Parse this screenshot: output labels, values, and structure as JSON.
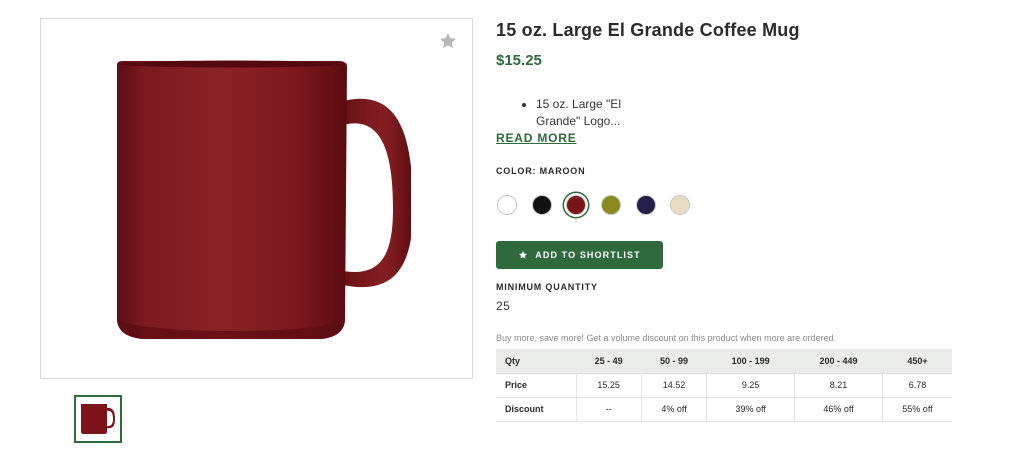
{
  "product": {
    "title": "15 oz. Large El Grande Coffee Mug",
    "price": "$15.25",
    "description_bullets": [
      "15 oz. Large \"El Grande\" Logo..."
    ],
    "read_more": "READ MORE"
  },
  "images": {
    "main_alt_icon": "mug-image",
    "favorite_icon": "star-icon",
    "thumbnail_icon": "mug-thumbnail"
  },
  "color": {
    "label": "COLOR: MAROON",
    "swatches": [
      {
        "name": "white",
        "hex": "#ffffff"
      },
      {
        "name": "black",
        "hex": "#111111"
      },
      {
        "name": "maroon",
        "hex": "#7a1418",
        "selected": true
      },
      {
        "name": "olive",
        "hex": "#8a8a1e"
      },
      {
        "name": "navy",
        "hex": "#23214a"
      },
      {
        "name": "almond",
        "hex": "#e8dcc4"
      }
    ]
  },
  "shortlist": {
    "label": "ADD TO SHORTLIST",
    "icon": "star-icon"
  },
  "minimum_quantity": {
    "label": "MINIMUM QUANTITY",
    "value": "25"
  },
  "volume": {
    "note": "Buy more, save more! Get a volume discount on this product when more are ordered.",
    "headers": [
      "Qty",
      "25 - 49",
      "50 - 99",
      "100 - 199",
      "200 - 449",
      "450+"
    ],
    "rows": [
      [
        "Price",
        "15.25",
        "14.52",
        "9.25",
        "8.21",
        "6.78"
      ],
      [
        "Discount",
        "--",
        "4% off",
        "39% off",
        "46% off",
        "55% off"
      ]
    ]
  },
  "colors": {
    "brand_green": "#2f6a3c",
    "mug_maroon": "#7a1418",
    "table_header_bg": "#e9ece8"
  }
}
